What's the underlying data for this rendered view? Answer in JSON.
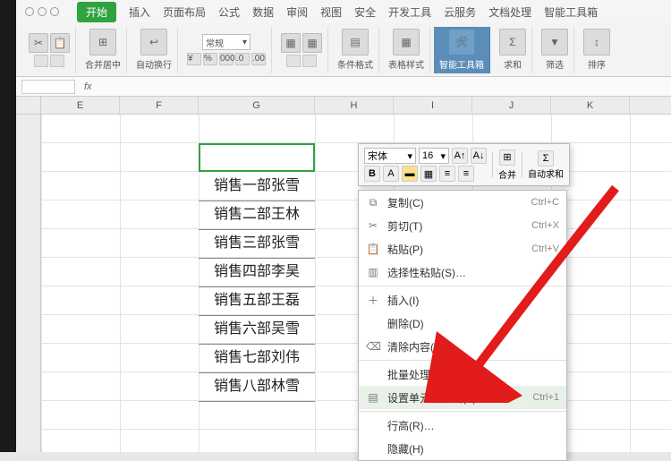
{
  "menu": {
    "active": "开始",
    "items": [
      "插入",
      "页面布局",
      "公式",
      "数据",
      "审阅",
      "视图",
      "安全",
      "开发工具",
      "云服务",
      "文档处理",
      "智能工具箱"
    ]
  },
  "ribbon": {
    "merge": "合并居中",
    "wrap": "自动换行",
    "format_sel": "常规",
    "cond": "条件格式",
    "tblstyle": "表格样式",
    "toolbox": "智能工具箱",
    "sum": "求和",
    "filter": "筛选",
    "sort": "排序"
  },
  "fx_label": "fx",
  "cols": [
    "E",
    "F",
    "G",
    "H",
    "I",
    "J",
    "K"
  ],
  "cells": [
    "销售一部张雪",
    "销售二部王林",
    "销售三部张雪",
    "销售四部李昊",
    "销售五部王磊",
    "销售六部吴雪",
    "销售七部刘伟",
    "销售八部林雪"
  ],
  "minitb": {
    "font": "宋体",
    "size": "16",
    "merge": "合并",
    "autosum": "自动求和"
  },
  "ctx": {
    "copy": {
      "t": "复制(C)",
      "sc": "Ctrl+C"
    },
    "cut": {
      "t": "剪切(T)",
      "sc": "Ctrl+X"
    },
    "paste": {
      "t": "粘贴(P)",
      "sc": "Ctrl+V"
    },
    "pspec": {
      "t": "选择性粘贴(S)…"
    },
    "insert": {
      "t": "插入(I)"
    },
    "delete": {
      "t": "删除(D)"
    },
    "clear": {
      "t": "清除内容(N)"
    },
    "batch": {
      "t": "批量处理单元格(P)"
    },
    "fmtcell": {
      "t": "设置单元格格式(F)…",
      "sc": "Ctrl+1"
    },
    "rowh": {
      "t": "行高(R)…"
    },
    "hide": {
      "t": "隐藏(H)"
    }
  }
}
